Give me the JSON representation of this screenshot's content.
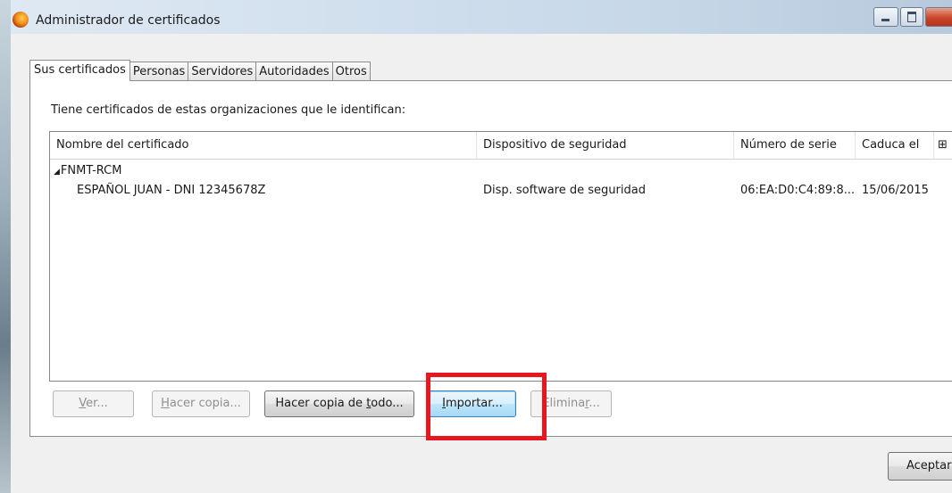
{
  "window": {
    "title": "Administrador de certificados"
  },
  "tabs": [
    {
      "label": "Sus certificados",
      "active": true
    },
    {
      "label": "Personas",
      "active": false
    },
    {
      "label": "Servidores",
      "active": false
    },
    {
      "label": "Autoridades",
      "active": false
    },
    {
      "label": "Otros",
      "active": false
    }
  ],
  "panel": {
    "description": "Tiene certificados de estas organizaciones que le identifican:"
  },
  "table": {
    "columns": [
      "Nombre del certificado",
      "Dispositivo de seguridad",
      "Número de serie",
      "Caduca el",
      "⊞"
    ],
    "group": "FNMT-RCM",
    "rows": [
      {
        "name": "ESPAÑOL JUAN - DNI 12345678Z",
        "device": "Disp. software de seguridad",
        "serial": "06:EA:D0:C4:89:8...",
        "expires": "15/06/2015"
      }
    ]
  },
  "buttons": {
    "ver": {
      "pre": "",
      "key": "V",
      "post": "er..."
    },
    "backup": {
      "pre": "",
      "key": "H",
      "post": "acer copia..."
    },
    "backup_all": {
      "pre": "Hacer copia de ",
      "key": "t",
      "post": "odo..."
    },
    "import": {
      "pre": "",
      "key": "I",
      "post": "mportar..."
    },
    "delete": {
      "pre": "Elimina",
      "key": "r",
      "post": "..."
    },
    "accept": "Aceptar"
  },
  "colors": {
    "highlight": "#e8161e",
    "focus_border": "#3c7fb1"
  }
}
